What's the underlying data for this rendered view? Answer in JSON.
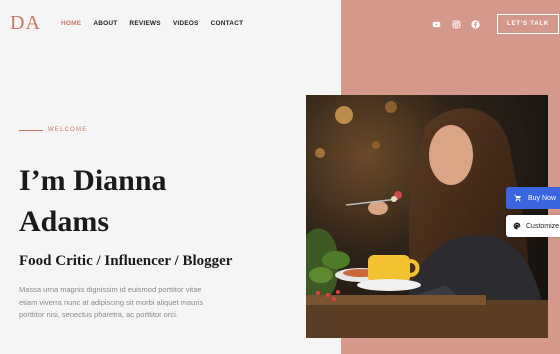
{
  "logo": "DA",
  "nav": {
    "home": "HOME",
    "about": "ABOUT",
    "reviews": "REVIEWS",
    "videos": "VIDEOS",
    "contact": "CONTACT"
  },
  "social": [
    "youtube-icon",
    "instagram-icon",
    "facebook-icon"
  ],
  "cta": "LET'S TALK",
  "hero": {
    "eyebrow": "WELCOME",
    "title": "I’m Dianna Adams",
    "subtitle": "Food Critic / Influencer / Blogger",
    "description": "Massa urna magnis dignissim id euismod porttitor vitae etiam viverra nunc at adipiscing sit morbi aliquet mauris porttitor nisi, senectus pharetra, ac porttitor orci."
  },
  "floating": {
    "buy_now": "Buy Now",
    "customize": "Customize"
  },
  "colors": {
    "accent": "#c27a67",
    "right_panel": "#d4998a",
    "buy_button": "#3c65e0"
  }
}
